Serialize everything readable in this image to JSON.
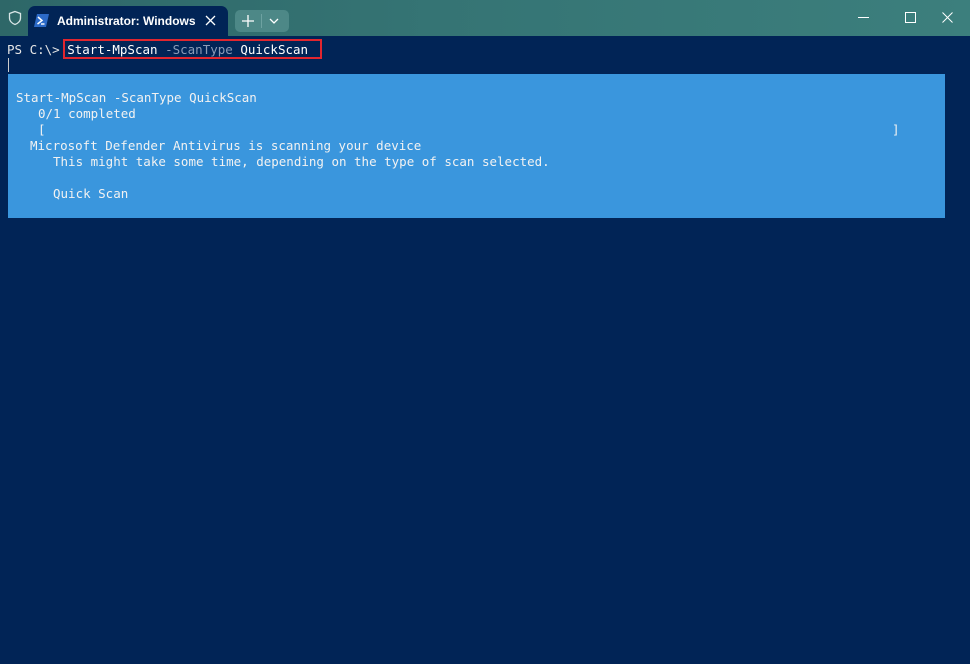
{
  "window": {
    "tab_title": "Administrator: Windows PowerShell",
    "new_tab_symbol": "+",
    "icons": [
      "shield-icon",
      "powershell-icon",
      "close-icon",
      "plus-icon",
      "chevron-down-icon",
      "minimize-icon",
      "maximize-icon",
      "window-close-icon"
    ]
  },
  "terminal": {
    "prompt": "PS C:\\> ",
    "command": {
      "cmdlet": "Start-MpScan",
      "parameter": "-ScanType",
      "argument": "QuickScan"
    },
    "progress": {
      "activity": "Start-MpScan -ScanType QuickScan",
      "completed": "0/1 completed",
      "bar_open": "[",
      "bar_close": "]",
      "status_title": "Microsoft Defender Antivirus is scanning your device",
      "status_detail": "This might take some time, depending on the type of scan selected.",
      "current_operation": "Quick Scan"
    }
  },
  "colors": {
    "terminal_bg": "#012456",
    "progress_bg": "#3a96dd",
    "highlight_border": "#e1262f",
    "titlebar": "#357474"
  }
}
